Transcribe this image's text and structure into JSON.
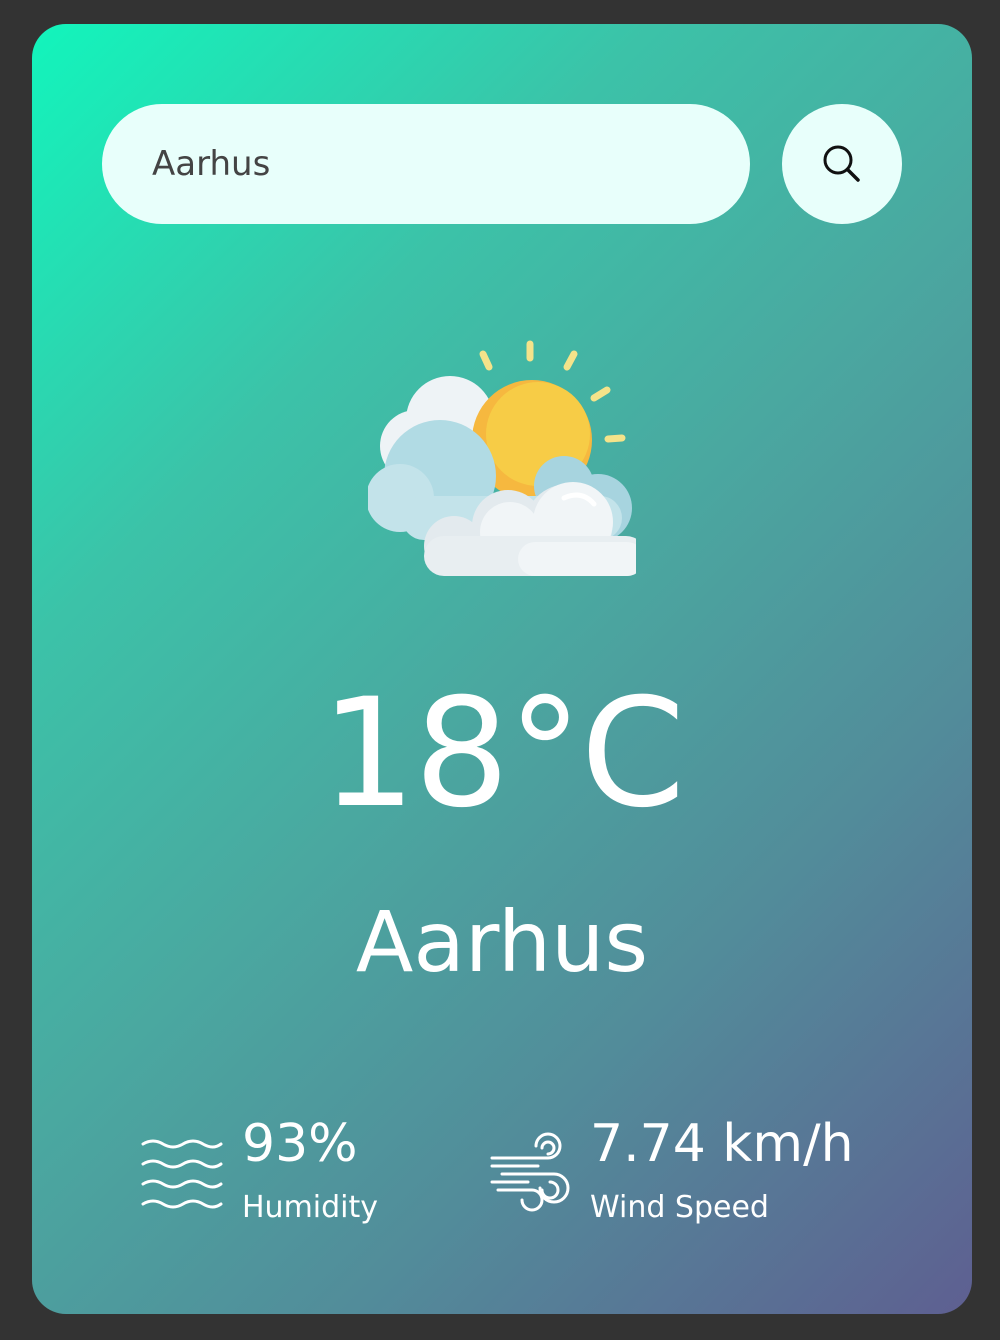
{
  "search": {
    "value": "Aarhus",
    "icon": "search-icon"
  },
  "weather": {
    "condition_icon": "partly-cloudy-icon",
    "temperature": "18°C",
    "city": "Aarhus"
  },
  "stats": {
    "humidity": {
      "value": "93%",
      "label": "Humidity",
      "icon": "humidity-waves-icon"
    },
    "wind": {
      "value": "7.74 km/h",
      "label": "Wind Speed",
      "icon": "wind-icon"
    }
  },
  "colors": {
    "gradient_start": "#12f5bc",
    "gradient_end": "#5e5f91",
    "input_background": "#e8fffb",
    "page_background": "#333333"
  }
}
